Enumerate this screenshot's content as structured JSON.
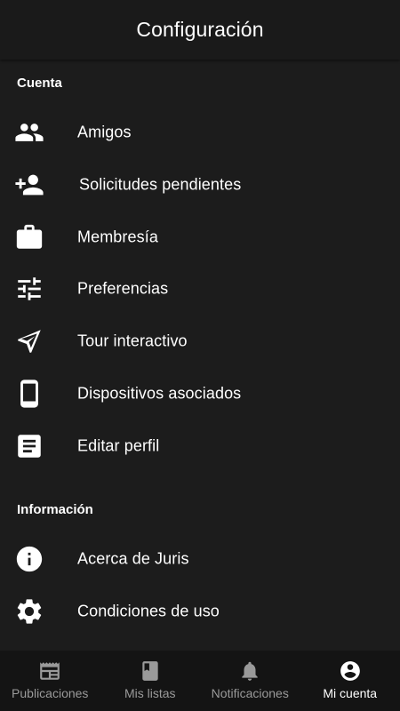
{
  "header": {
    "title": "Configuración"
  },
  "sections": {
    "account": {
      "title": "Cuenta",
      "items": [
        {
          "label": "Amigos",
          "icon": "people-icon"
        },
        {
          "label": "Solicitudes pendientes",
          "icon": "person-add-icon"
        },
        {
          "label": "Membresía",
          "icon": "briefcase-icon"
        },
        {
          "label": "Preferencias",
          "icon": "tune-sliders-icon"
        },
        {
          "label": "Tour interactivo",
          "icon": "send-paper-plane-icon"
        },
        {
          "label": "Dispositivos asociados",
          "icon": "smartphone-icon"
        },
        {
          "label": "Editar perfil",
          "icon": "document-icon"
        }
      ]
    },
    "info": {
      "title": "Información",
      "items": [
        {
          "label": "Acerca de Juris",
          "icon": "info-icon"
        },
        {
          "label": "Condiciones de uso",
          "icon": "gear-icon"
        }
      ]
    }
  },
  "bottom_nav": {
    "items": [
      {
        "label": "Publicaciones",
        "icon": "newspaper-icon",
        "active": false
      },
      {
        "label": "Mis listas",
        "icon": "book-icon",
        "active": false
      },
      {
        "label": "Notificaciones",
        "icon": "bell-icon",
        "active": false
      },
      {
        "label": "Mi cuenta",
        "icon": "account-circle-icon",
        "active": true
      }
    ]
  },
  "colors": {
    "background": "#1c1c1c",
    "header_bg": "#1a1a1a",
    "nav_bg": "#141414",
    "text": "#ffffff",
    "nav_inactive": "#9a9a9a"
  }
}
